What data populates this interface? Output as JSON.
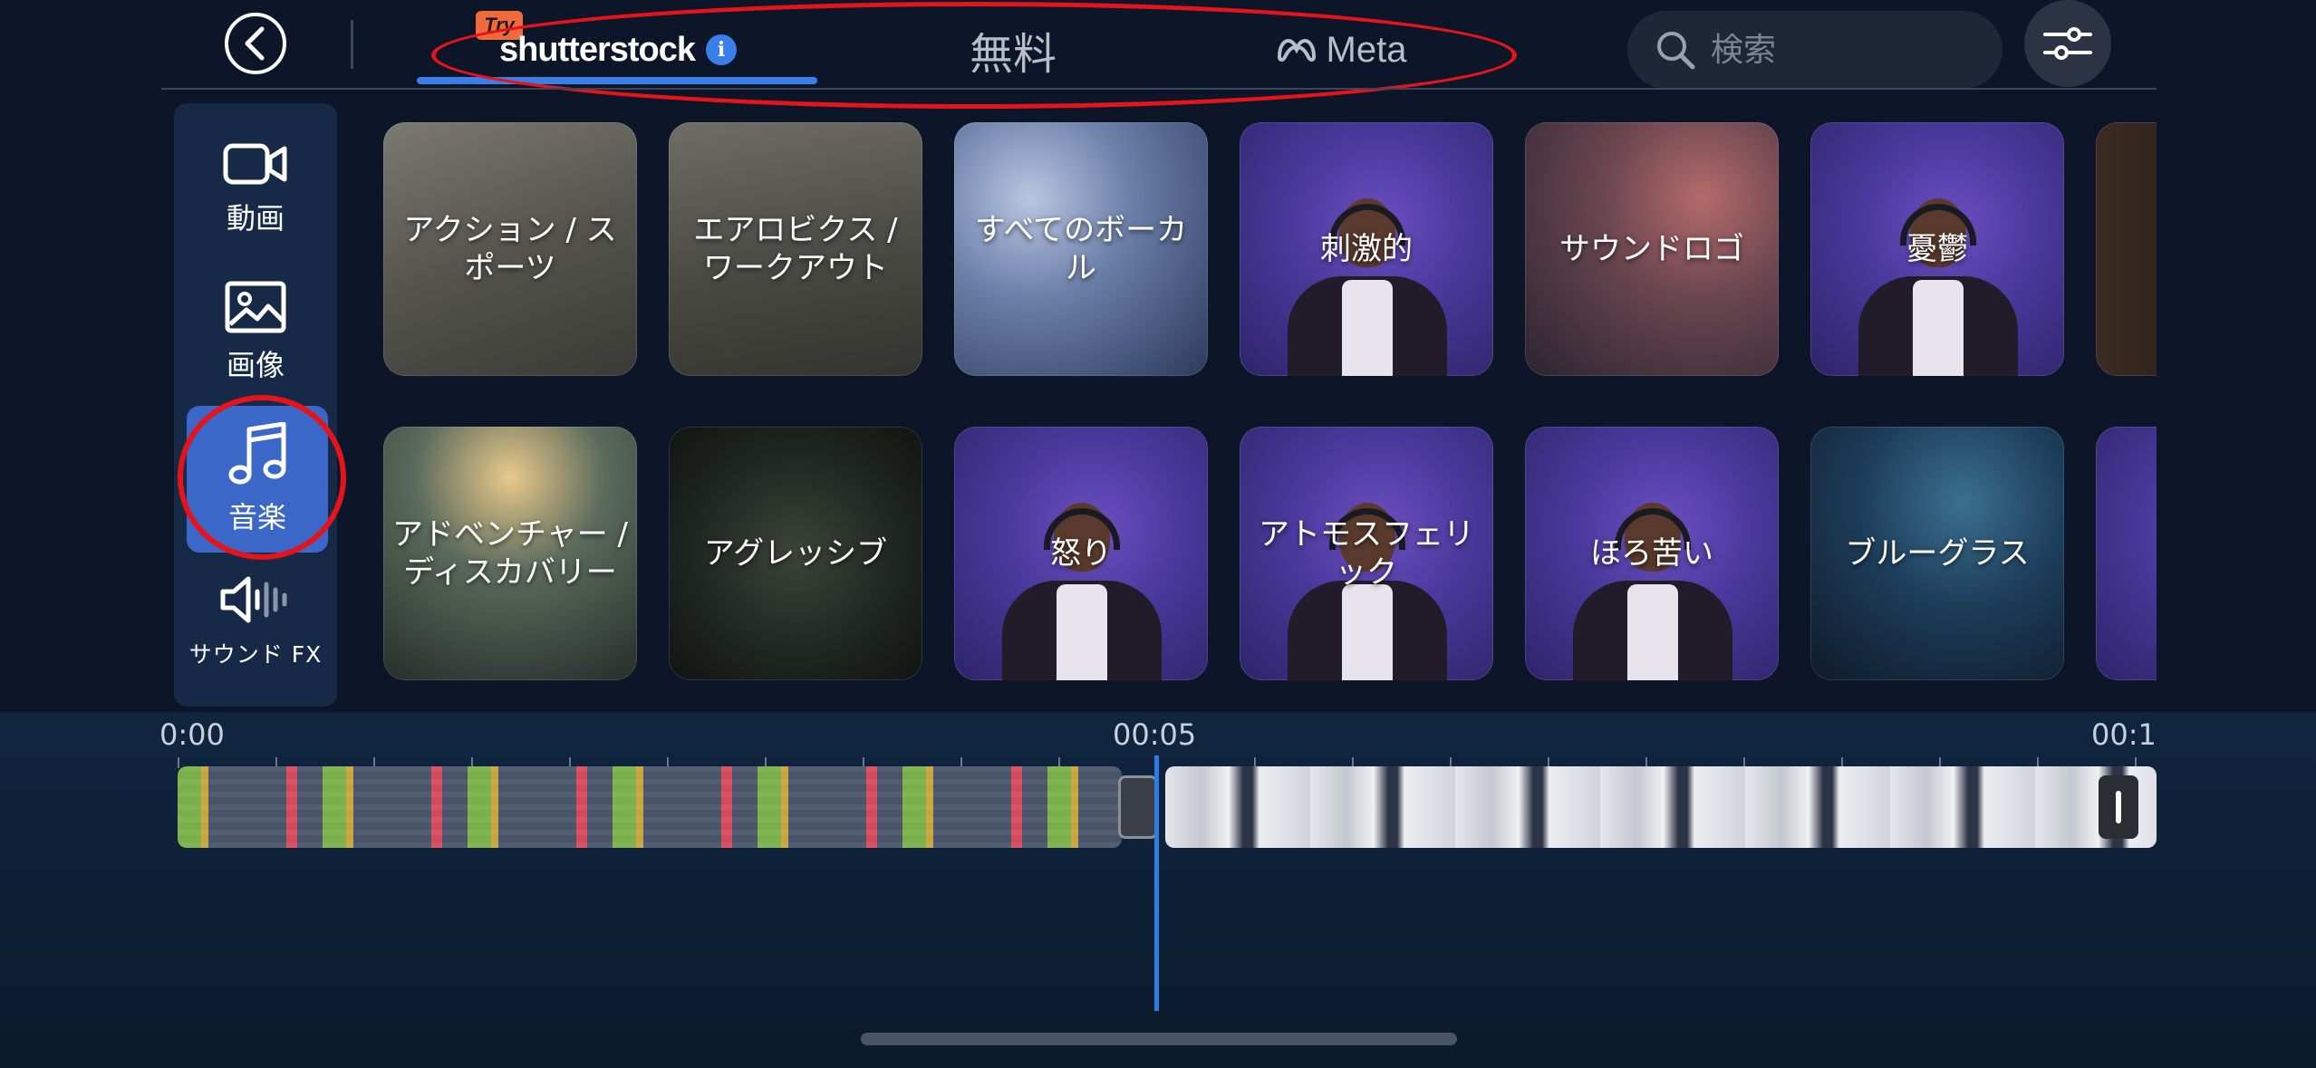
{
  "header": {
    "back_icon": "chevron-left-icon",
    "tabs": [
      {
        "label": "shutterstock",
        "badge": "Try",
        "info_icon": "i",
        "active": true
      },
      {
        "label": "無料",
        "active": false
      },
      {
        "label": "Meta",
        "icon": "meta-logo-icon",
        "active": false
      }
    ],
    "search": {
      "placeholder": "検索",
      "icon": "search-icon"
    },
    "filter_icon": "sliders-icon"
  },
  "sidebar": {
    "items": [
      {
        "label": "動画",
        "icon": "video-camera-icon",
        "active": false
      },
      {
        "label": "画像",
        "icon": "image-icon",
        "active": false
      },
      {
        "label": "音楽",
        "icon": "music-note-icon",
        "active": true
      },
      {
        "label": "サウンド FX",
        "icon": "speaker-waveform-icon",
        "active": false
      }
    ]
  },
  "grid": {
    "row1": [
      {
        "label": "アクション / スポーツ"
      },
      {
        "label": "エアロビクス / ワークアウト"
      },
      {
        "label": "すべてのボーカル"
      },
      {
        "label": "刺激的"
      },
      {
        "label": "サウンドロゴ"
      },
      {
        "label": "憂鬱"
      },
      {
        "label": ""
      }
    ],
    "row2": [
      {
        "label": "アドベンチャー / ディスカバリー"
      },
      {
        "label": "アグレッシブ"
      },
      {
        "label": "怒り"
      },
      {
        "label": "アトモスフェリック"
      },
      {
        "label": "ほろ苦い"
      },
      {
        "label": "ブルーグラス"
      },
      {
        "label": ""
      }
    ]
  },
  "timeline": {
    "time_start": "0:00",
    "time_mid": "00:05",
    "time_end": "00:1"
  },
  "colors": {
    "background": "#0c1628",
    "accent_blue": "#3a7fe8",
    "annotation_red": "#e5141b",
    "sidebar_bg": "#162a48",
    "active_item": "#3a67c8"
  }
}
